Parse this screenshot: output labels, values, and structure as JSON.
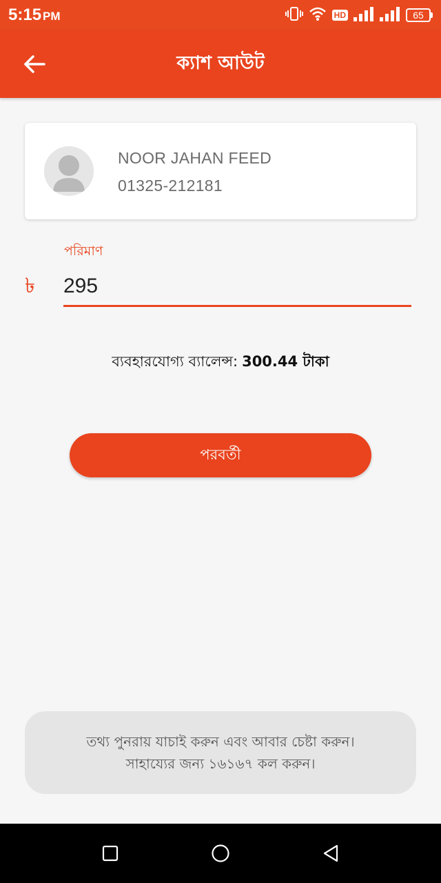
{
  "status_bar": {
    "time": "5:15",
    "ampm": "PM",
    "network_badge": "HD",
    "battery_level": "65",
    "icons": [
      "vibrate-icon",
      "wifi-icon",
      "signal-icon",
      "signal-icon",
      "battery-icon"
    ]
  },
  "app_bar": {
    "title": "ক্যাশ আউট",
    "back_icon": "arrow-left-icon"
  },
  "recipient": {
    "name": "NOOR JAHAN FEED",
    "phone": "01325-212181",
    "avatar_icon": "person-icon"
  },
  "amount": {
    "label": "পরিমাণ",
    "currency_symbol": "৳",
    "value": "295"
  },
  "balance": {
    "label": "ব্যবহারযোগ্য ব্যালেন্স:",
    "value": "300.44 টাকা"
  },
  "next_button": {
    "label": "পরবর্তী"
  },
  "toast": {
    "line1": "তথ্য পুনরায় যাচাই করুন এবং আবার চেষ্টা করুন।",
    "line2": "সাহায্যের জন্য ১৬১৬৭ কল করুন।"
  },
  "nav_bar": {
    "buttons": [
      "recents-square-icon",
      "home-circle-icon",
      "back-triangle-icon"
    ]
  },
  "colors": {
    "accent": "#e9441e",
    "status_bar": "#e9491f",
    "background": "#f6f6f6",
    "toast_bg": "#e5e5e5"
  }
}
